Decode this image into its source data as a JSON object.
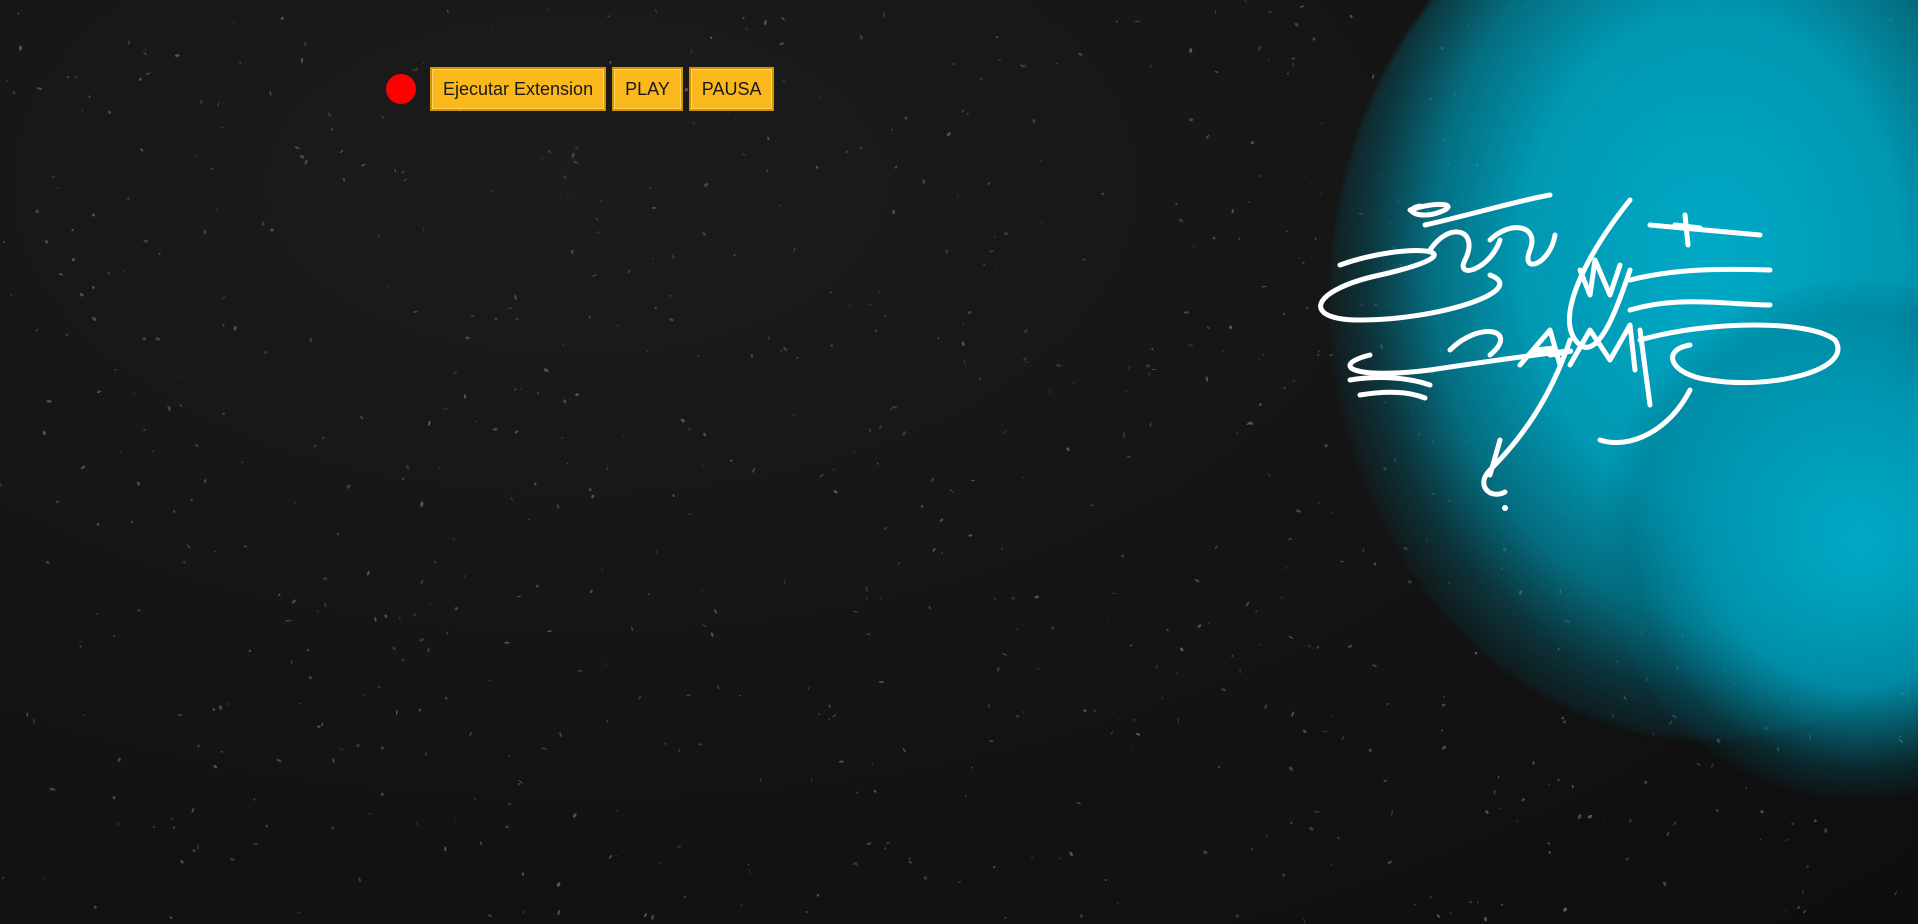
{
  "toolbar": {
    "record_indicator_color": "#ff0000",
    "run_extension_label": "Ejecutar Extension",
    "play_label": "PLAY",
    "pause_label": "PAUSA",
    "button_color": "#fbb81c"
  },
  "artwork": {
    "accent_color": "#00aac6",
    "background_color": "#141414"
  }
}
